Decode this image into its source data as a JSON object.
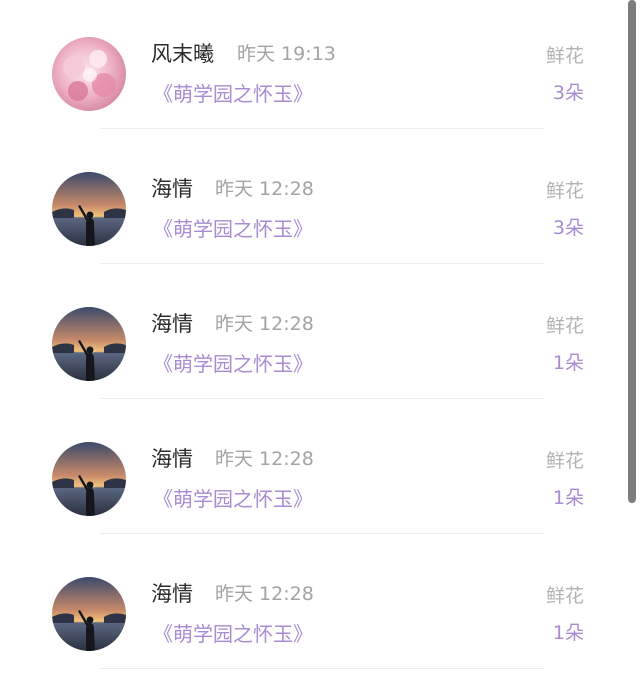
{
  "colors": {
    "accent_purple": "#a98bd2",
    "name_text": "#2b2b2b",
    "muted_text": "#a3a3a3",
    "divider": "#ececec",
    "scrollbar": "#7d7d7d"
  },
  "items": [
    {
      "user": "风末曦",
      "time": "昨天 19:13",
      "book": "《萌学园之怀玉》",
      "gift_type": "鲜花",
      "gift_count": "3朵",
      "avatar_icon": "pink-floral-avatar"
    },
    {
      "user": "海情",
      "time": "昨天 12:28",
      "book": "《萌学园之怀玉》",
      "gift_type": "鲜花",
      "gift_count": "3朵",
      "avatar_icon": "sunset-sea-avatar"
    },
    {
      "user": "海情",
      "time": "昨天 12:28",
      "book": "《萌学园之怀玉》",
      "gift_type": "鲜花",
      "gift_count": "1朵",
      "avatar_icon": "sunset-sea-avatar"
    },
    {
      "user": "海情",
      "time": "昨天 12:28",
      "book": "《萌学园之怀玉》",
      "gift_type": "鲜花",
      "gift_count": "1朵",
      "avatar_icon": "sunset-sea-avatar"
    },
    {
      "user": "海情",
      "time": "昨天 12:28",
      "book": "《萌学园之怀玉》",
      "gift_type": "鲜花",
      "gift_count": "1朵",
      "avatar_icon": "sunset-sea-avatar"
    }
  ]
}
